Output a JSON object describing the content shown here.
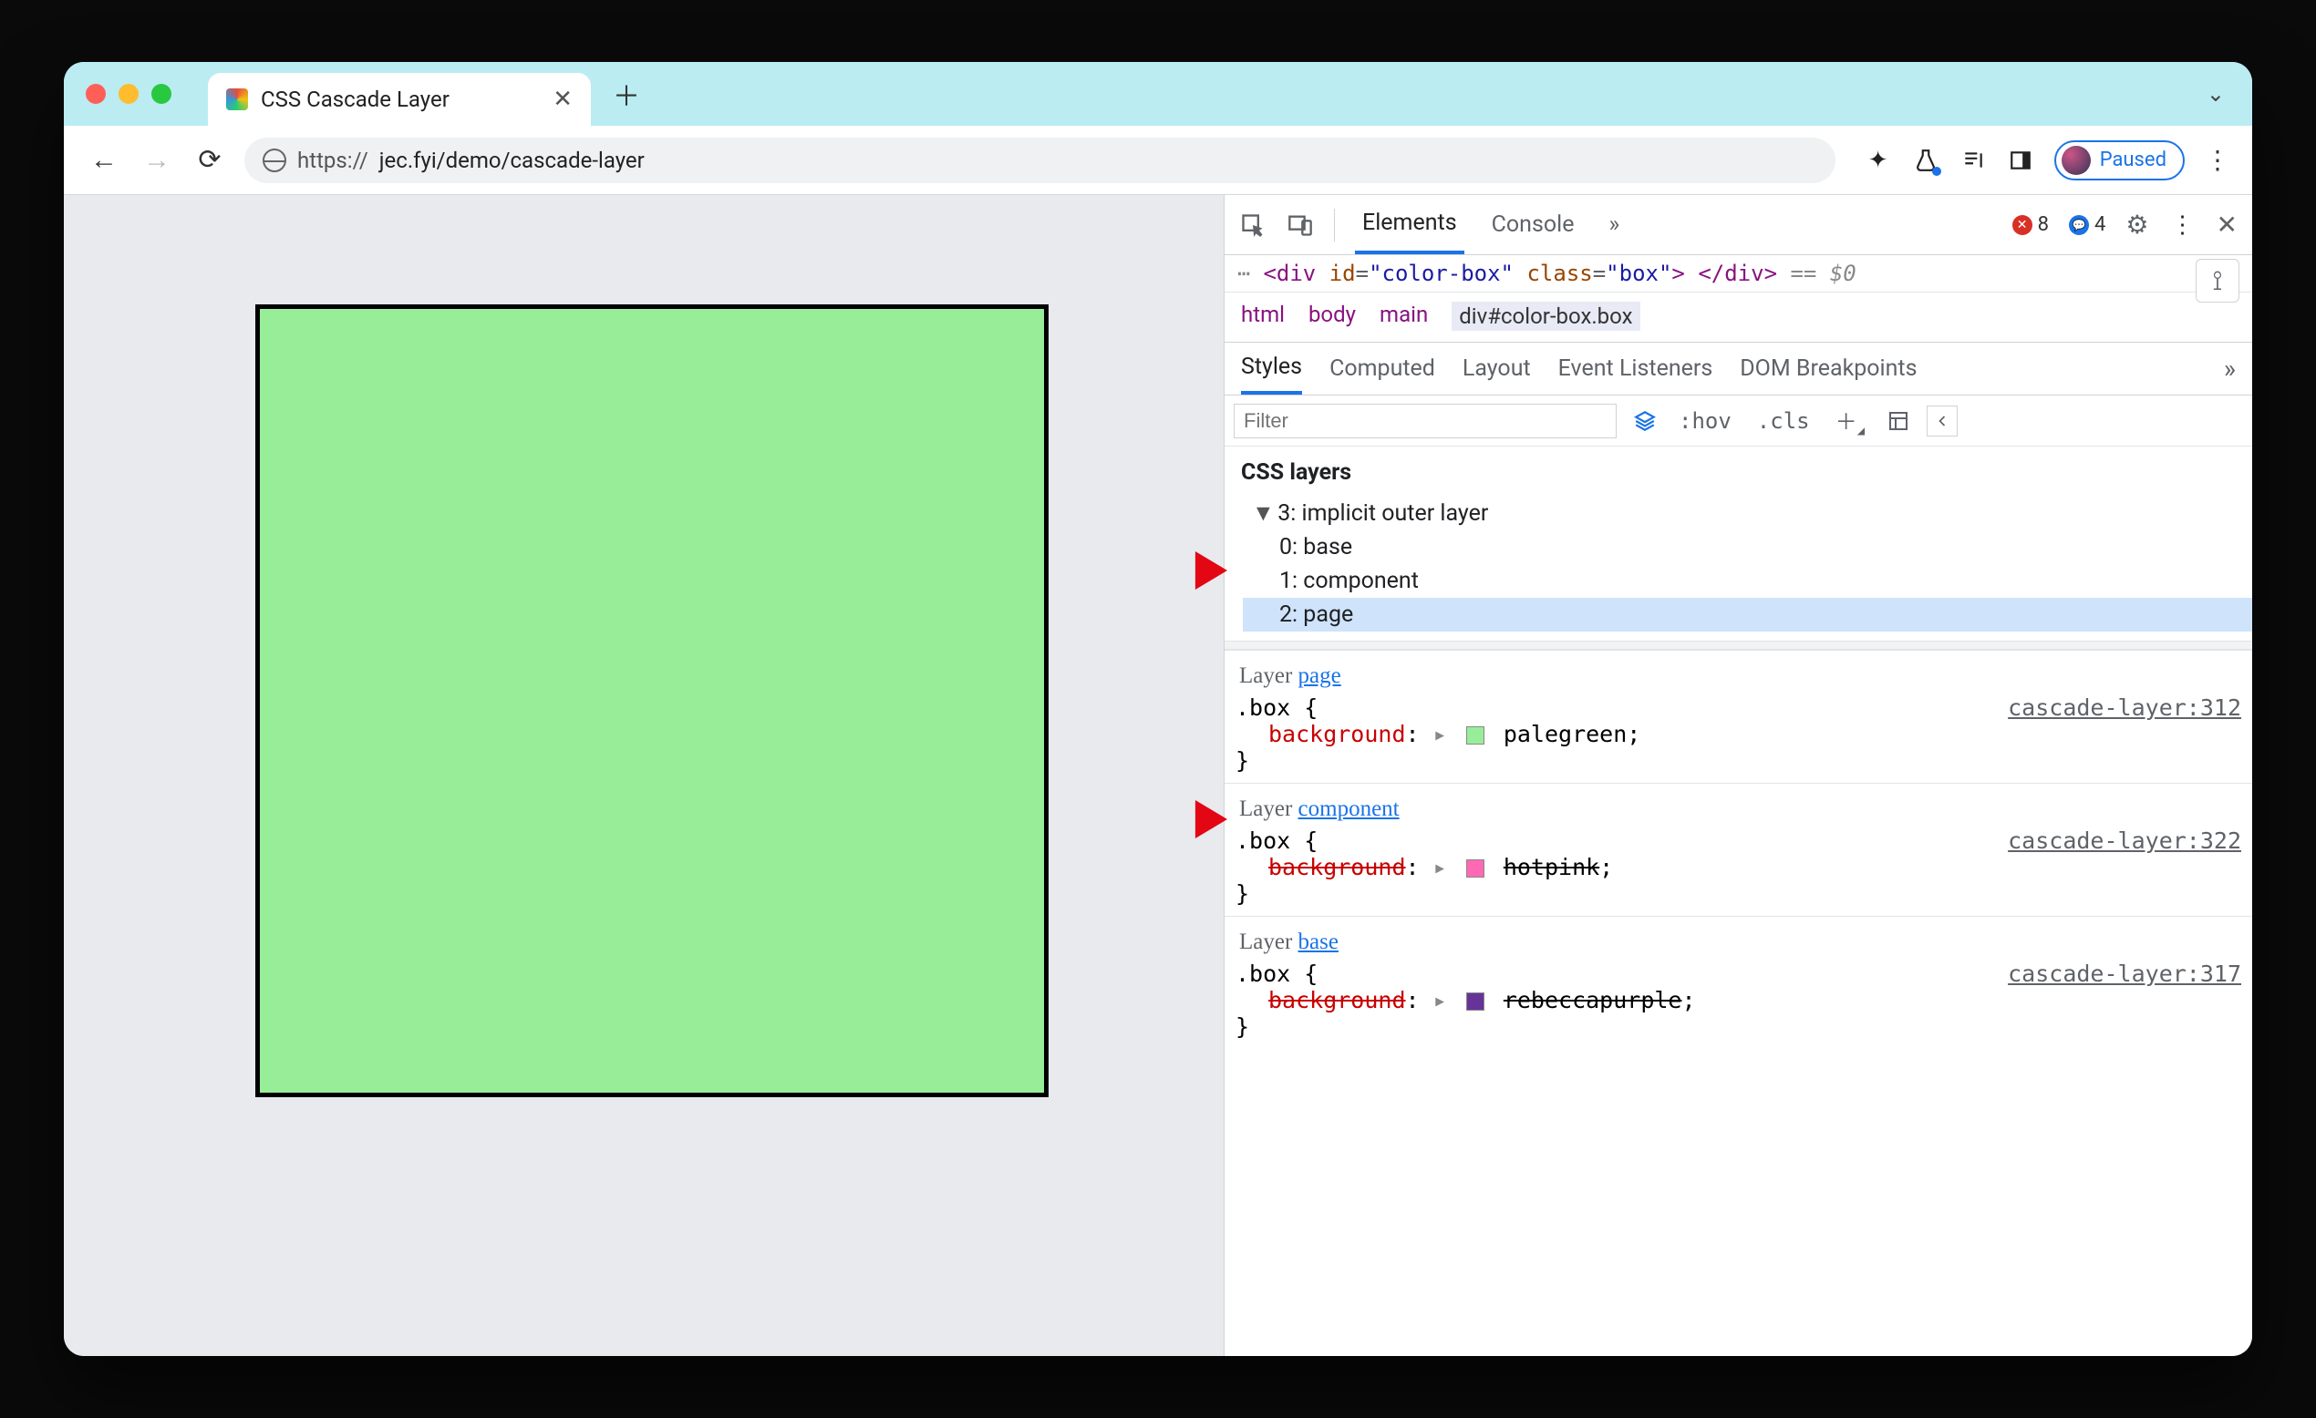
{
  "tab": {
    "title": "CSS Cascade Layer"
  },
  "url": {
    "scheme": "https://",
    "rest": "jec.fyi/demo/cascade-layer"
  },
  "pausedLabel": "Paused",
  "devtools": {
    "tabs": {
      "elements": "Elements",
      "console": "Console"
    },
    "badges": {
      "errors": "8",
      "info": "4"
    },
    "sourceLine": {
      "open": "<div",
      "idAttr": "id",
      "idVal": "\"color-box\"",
      "classAttr": "class",
      "classVal": "\"box\"",
      "close": "> </div>",
      "eq": "== $0"
    },
    "crumbs": [
      "html",
      "body",
      "main"
    ],
    "crumbSelected": "div#color-box.box",
    "subtabs": {
      "styles": "Styles",
      "computed": "Computed",
      "layout": "Layout",
      "events": "Event Listeners",
      "dom": "DOM Breakpoints"
    },
    "filterPlaceholder": "Filter",
    "hov": ":hov",
    "cls": ".cls",
    "cssLayersTitle": "CSS layers",
    "tree": {
      "parent": "3: implicit outer layer",
      "items": [
        "0: base",
        "1: component",
        "2: page"
      ],
      "selectedIdx": 2
    },
    "rules": [
      {
        "layerLabelPrefix": "Layer ",
        "layerName": "page",
        "selector": ".box {",
        "prop": "background",
        "value": "palegreen",
        "swatch": "#98ee98",
        "src": "cascade-layer:312",
        "overridden": false,
        "close": "}"
      },
      {
        "layerLabelPrefix": "Layer ",
        "layerName": "component",
        "selector": ".box {",
        "prop": "background",
        "value": "hotpink",
        "swatch": "#ff69b4",
        "src": "cascade-layer:322",
        "overridden": true,
        "close": "}"
      },
      {
        "layerLabelPrefix": "Layer ",
        "layerName": "base",
        "selector": ".box {",
        "prop": "background",
        "value": "rebeccapurple",
        "swatch": "#663399",
        "src": "cascade-layer:317",
        "overridden": true,
        "close": "}"
      }
    ]
  }
}
